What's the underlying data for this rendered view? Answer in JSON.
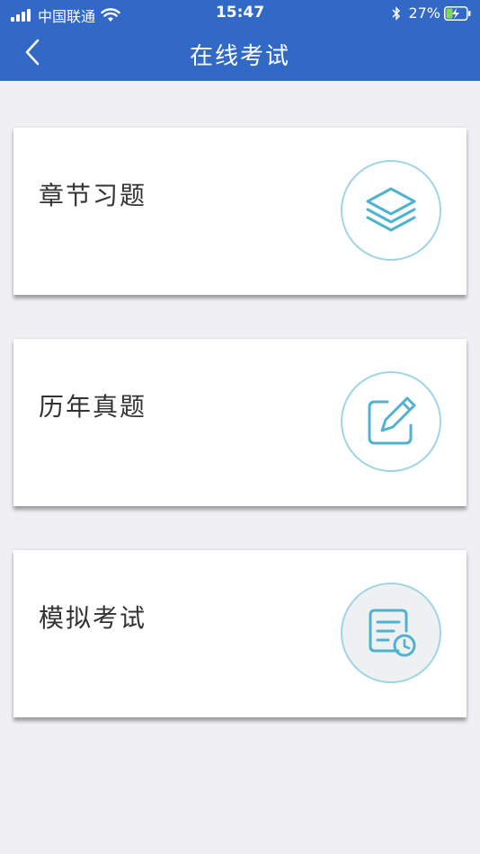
{
  "status_bar": {
    "carrier": "中国联通",
    "time": "15:47",
    "battery": "27%"
  },
  "nav": {
    "title": "在线考试"
  },
  "cards": [
    {
      "label": "章节习题",
      "icon": "layers-icon"
    },
    {
      "label": "历年真题",
      "icon": "edit-icon"
    },
    {
      "label": "模拟考试",
      "icon": "document-clock-icon"
    }
  ],
  "colors": {
    "header_bg": "#3269c7",
    "page_bg": "#efeff4",
    "icon_stroke": "#4fb3cf",
    "icon_ring": "#9fd6e6"
  }
}
